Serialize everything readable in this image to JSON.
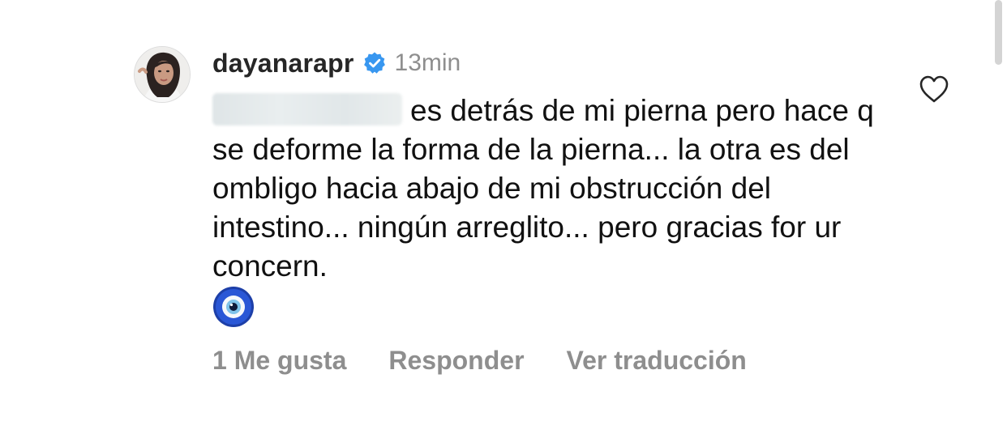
{
  "comment": {
    "username": "dayanarapr",
    "verified": true,
    "timestamp": "13min",
    "text_after_mention": "es detrás de mi pierna pero hace q se deforme la forma de la pierna... la otra es del ombligo hacia abajo de mi obstrucción del intestino... ningún arreglito... pero gracias for ur concern.",
    "emoji": "🧿",
    "likes_label": "1 Me gusta",
    "reply_label": "Responder",
    "translate_label": "Ver traducción"
  },
  "icons": {
    "avatar": "profile-photo",
    "verified": "verified-badge-icon",
    "like": "heart-outline-icon",
    "emoji": "nazar-amulet"
  },
  "colors": {
    "username": "#262626",
    "secondary": "#8e8e8e",
    "verified_badge": "#3897f0",
    "body_text": "#111111"
  }
}
